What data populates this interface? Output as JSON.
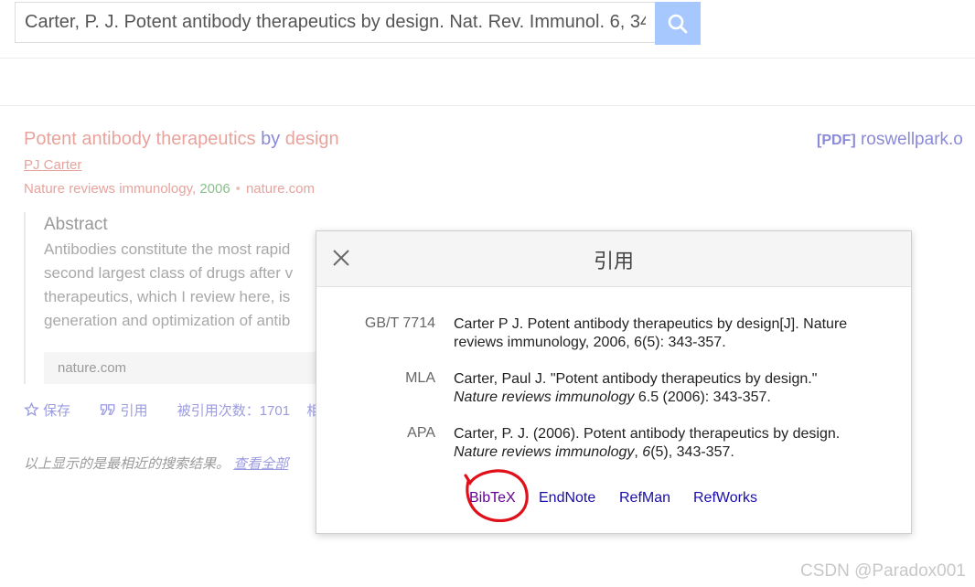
{
  "search": {
    "query": "Carter, P. J. Potent antibody therapeutics by design. Nat. Rev. Immunol. 6, 34",
    "button_icon": "search-icon",
    "button_color": "#a6c8ff"
  },
  "result": {
    "title_part1": "Potent antibody therapeutics ",
    "title_part2": "by",
    "title_part3": " design",
    "pdf_tag": "[PDF]",
    "pdf_domain": "roswellpark.o",
    "author": "PJ Carter",
    "source_journal": "Nature reviews immunology, ",
    "source_year": "2006",
    "source_dot": "•",
    "source_site": "nature.com",
    "abstract_heading": "Abstract",
    "abstract_lines": [
      "Antibodies constitute the most rapid",
      "second largest class of drugs after v",
      "therapeutics, which I review here, is",
      "generation and optimization of antib"
    ],
    "abstract_source": "nature.com",
    "actions": {
      "save": "保存",
      "cite": "引用",
      "cited_by": "被引用次数：1701",
      "related": "相关"
    },
    "note_text": "以上显示的是最相近的搜索结果。",
    "note_link": "查看全部"
  },
  "dialog": {
    "title": "引用",
    "citations": [
      {
        "style": "GB/T 7714",
        "text_plain": "Carter P J. Potent antibody therapeutics by design[J]. Nature reviews immunology, 2006, 6(5): 343-357."
      },
      {
        "style": "MLA",
        "text_line1": "Carter, Paul J. \"Potent antibody therapeutics by design.\"",
        "text_italic": "Nature reviews immunology",
        "text_rest": " 6.5 (2006): 343-357."
      },
      {
        "style": "APA",
        "text_line1": "Carter, P. J. (2006). Potent antibody therapeutics by design.",
        "text_italic": "Nature reviews immunology",
        "text_mid": ", ",
        "text_italic2": "6",
        "text_rest": "(5), 343-357."
      }
    ],
    "export_links": [
      "BibTeX",
      "EndNote",
      "RefMan",
      "RefWorks"
    ],
    "annotation_color": "#e0101a"
  },
  "watermark": "CSDN @Paradox001"
}
